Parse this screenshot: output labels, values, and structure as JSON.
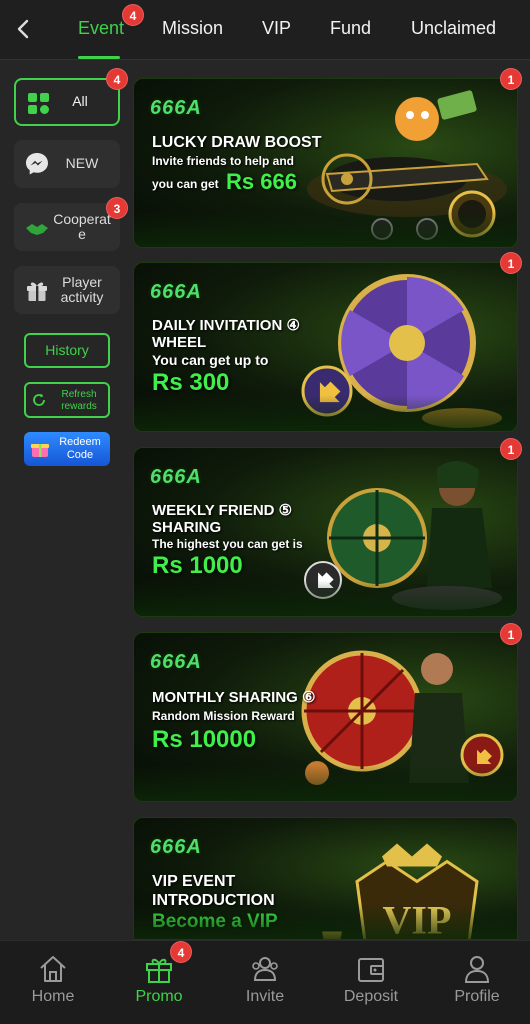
{
  "tabs": [
    {
      "label": "Event",
      "active": true,
      "badge": "4"
    },
    {
      "label": "Mission"
    },
    {
      "label": "VIP"
    },
    {
      "label": "Fund"
    },
    {
      "label": "Unclaimed"
    }
  ],
  "sidebar": {
    "items": [
      {
        "label": "All",
        "icon": "grid-icon",
        "badge": "4",
        "active": true
      },
      {
        "label": "NEW",
        "icon": "messenger-icon"
      },
      {
        "label": "Cooperat e",
        "icon": "handshake-icon",
        "badge": "3"
      },
      {
        "label": "Player activity",
        "icon": "gift-icon"
      }
    ],
    "history": "History",
    "refresh": "Refresh rewards",
    "redeem": "Redeem Code"
  },
  "banners": [
    {
      "brand": "666A",
      "title": "LUCKY DRAW BOOST",
      "sub1": "Invite friends to help and",
      "sub2": "you can get",
      "amount": "Rs 666",
      "badge": "1"
    },
    {
      "brand": "666A",
      "title1": "DAILY INVITATION ④",
      "title2": "WHEEL",
      "sub": "You can get up to",
      "amount": "Rs 300",
      "badge": "1"
    },
    {
      "brand": "666A",
      "title1": "WEEKLY FRIEND ⑤",
      "title2": "SHARING",
      "sub": "The highest you can get is",
      "amount": "Rs 1000",
      "badge": "1"
    },
    {
      "brand": "666A",
      "title": "MONTHLY SHARING ⑥",
      "sub": "Random Mission Reward",
      "amount": "Rs 10000",
      "badge": "1"
    },
    {
      "brand": "666A",
      "title1": "VIP EVENT",
      "title2": "INTRODUCTION",
      "amount": "Become a VIP",
      "art_text": "VIP"
    }
  ],
  "bottom_nav": [
    {
      "label": "Home",
      "icon": "home-icon"
    },
    {
      "label": "Promo",
      "icon": "gift-box-icon",
      "active": true,
      "badge": "4"
    },
    {
      "label": "Invite",
      "icon": "users-icon"
    },
    {
      "label": "Deposit",
      "icon": "wallet-icon"
    },
    {
      "label": "Profile",
      "icon": "person-icon"
    }
  ],
  "colors": {
    "accent": "#3fd24a",
    "badge": "#e53935",
    "bg": "#262626"
  }
}
